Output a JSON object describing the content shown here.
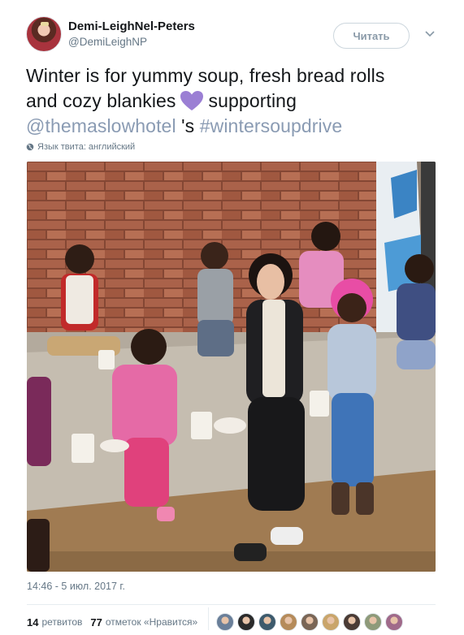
{
  "author": {
    "display_name": "Demi-LeighNel-Peters",
    "handle": "@DemiLeighNP"
  },
  "follow_button": {
    "label": "Читать"
  },
  "tweet": {
    "line1": "Winter is for yummy soup, fresh bread rolls",
    "line2_pre": "and cozy blankies",
    "line2_post": "supporting",
    "mention": "@themaslowhotel",
    "mention_suffix": " 's ",
    "hashtag": "#wintersoupdrive",
    "emoji_icon": "purple-heart-icon"
  },
  "language_note": "Язык твита: английский",
  "timestamp": "14:46 - 5 июл. 2017 г.",
  "stats": {
    "retweets_count": "14",
    "retweets_label": "ретвитов",
    "likes_count": "77",
    "likes_label": "отметок «Нравится»"
  },
  "colors": {
    "link": "#8a9bb3",
    "text": "#14171a",
    "muted": "#657786",
    "heart": "#9b7fd4"
  },
  "liker_colors": [
    "#6a7f99",
    "#2b2b2b",
    "#3d5a6c",
    "#b58b5a",
    "#7a6656",
    "#c9a56b",
    "#4a3b35",
    "#8e9a7a",
    "#a06a8a"
  ]
}
